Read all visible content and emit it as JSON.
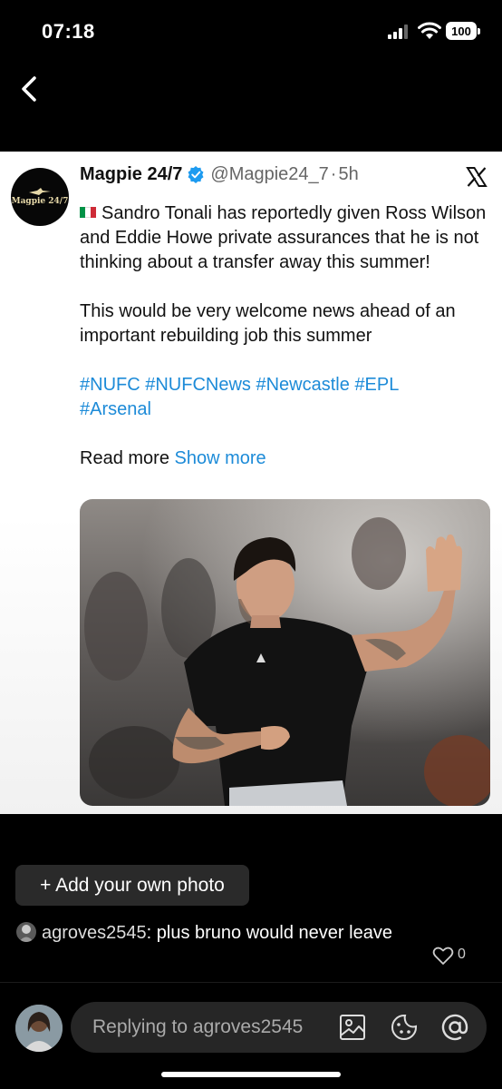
{
  "status_bar": {
    "time": "07:18",
    "battery": "100"
  },
  "tweet": {
    "display_name": "Magpie 24/7",
    "handle": "@Magpie24_7",
    "separator": "·",
    "age": "5h",
    "avatar_text": "Magpie 24/7",
    "text_line1": "Sandro Tonali has reportedly given Ross Wilson and Eddie Howe private assurances that he is not thinking about a transfer away this summer!",
    "text_line2": "This would be very welcome news ahead of an important rebuilding job this summer",
    "hashtags": [
      "#NUFC",
      "#NUFCNews",
      "#Newcastle",
      "#EPL",
      "#Arsenal"
    ],
    "read_more": "Read more",
    "show_more": "Show more"
  },
  "add_photo_label": "+ Add your own photo",
  "comment": {
    "username": "agroves2545",
    "text": ": plus bruno would never leave",
    "likes": "0"
  },
  "reply": {
    "placeholder": "Replying to agroves2545"
  },
  "colors": {
    "link": "#1d8bd8",
    "background": "#000000",
    "card": "#ffffff"
  },
  "icons": [
    "back-chevron-icon",
    "signal-icon",
    "wifi-icon",
    "verified-badge-icon",
    "x-logo-icon",
    "heart-icon",
    "image-icon",
    "sticker-icon",
    "mention-icon"
  ]
}
